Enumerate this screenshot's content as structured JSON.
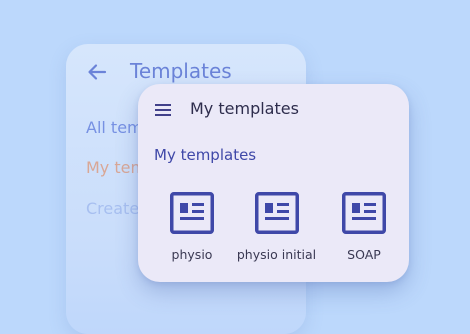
{
  "back_panel": {
    "title": "Templates",
    "back_icon": "arrow-left-icon",
    "items": [
      {
        "label": "All tem"
      },
      {
        "label": "My tem"
      },
      {
        "label": "Create"
      }
    ]
  },
  "front_card": {
    "menu_icon": "hamburger-menu-icon",
    "title": "My templates",
    "section_label": "My templates",
    "templates": [
      {
        "label": "physio",
        "icon": "template-document-icon"
      },
      {
        "label": "physio initial",
        "icon": "template-document-icon"
      },
      {
        "label": "SOAP",
        "icon": "template-document-icon"
      }
    ]
  },
  "colors": {
    "background": "#bcd8fc",
    "card": "#ebe9f8",
    "icon_stroke": "#3f48a8",
    "accent_selected": "#d9a796"
  }
}
